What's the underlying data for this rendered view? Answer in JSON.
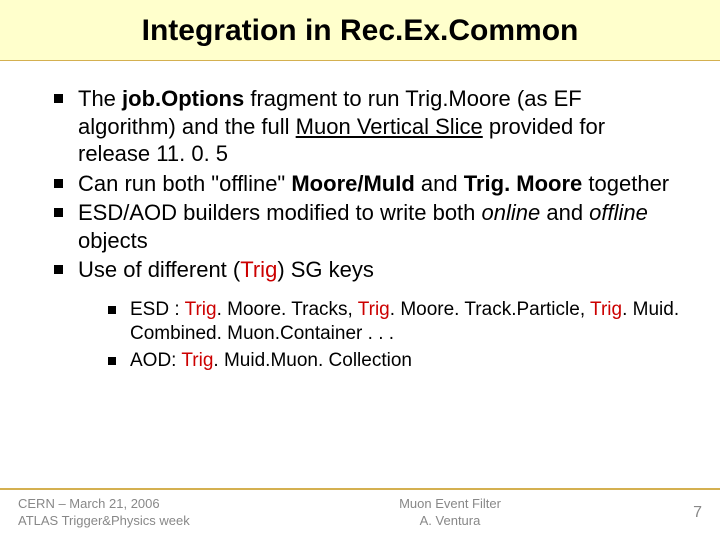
{
  "title": "Integration in Rec.Ex.Common",
  "bullets": {
    "b1_pre": "The ",
    "b1_bold": "job.Options",
    "b1_mid": " fragment to run Trig.Moore (as EF algorithm) and the full ",
    "b1_u": "Muon Vertical Slice",
    "b1_post": " provided for release 11. 0. 5",
    "b2_pre": "Can run both \"offline\" ",
    "b2_bold": "Moore/MuId",
    "b2_mid": " and ",
    "b2_bold2": "Trig. Moore",
    "b2_post": " together",
    "b3_pre": "ESD/AOD builders modified to write both ",
    "b3_i1": "online",
    "b3_mid": " and ",
    "b3_i2": "offline",
    "b3_post": " objects",
    "b4_pre": "Use of different (",
    "b4_red": "Trig",
    "b4_post": ") SG keys"
  },
  "subbullets": {
    "s1_pre": "ESD : ",
    "s1_r1": "Trig",
    "s1_t1": ". Moore. Tracks, ",
    "s1_r2": "Trig",
    "s1_t2": ". Moore. Track.Particle, ",
    "s1_r3": "Trig",
    "s1_t3": ". Muid. Combined. Muon.Container . . .",
    "s2_pre": "AOD: ",
    "s2_r1": "Trig",
    "s2_t1": ". Muid.Muon. Collection"
  },
  "footer": {
    "left1": "CERN – March 21, 2006",
    "left2": "ATLAS Trigger&Physics week",
    "center1": "Muon Event Filter",
    "center2": "A. Ventura",
    "page": "7"
  }
}
